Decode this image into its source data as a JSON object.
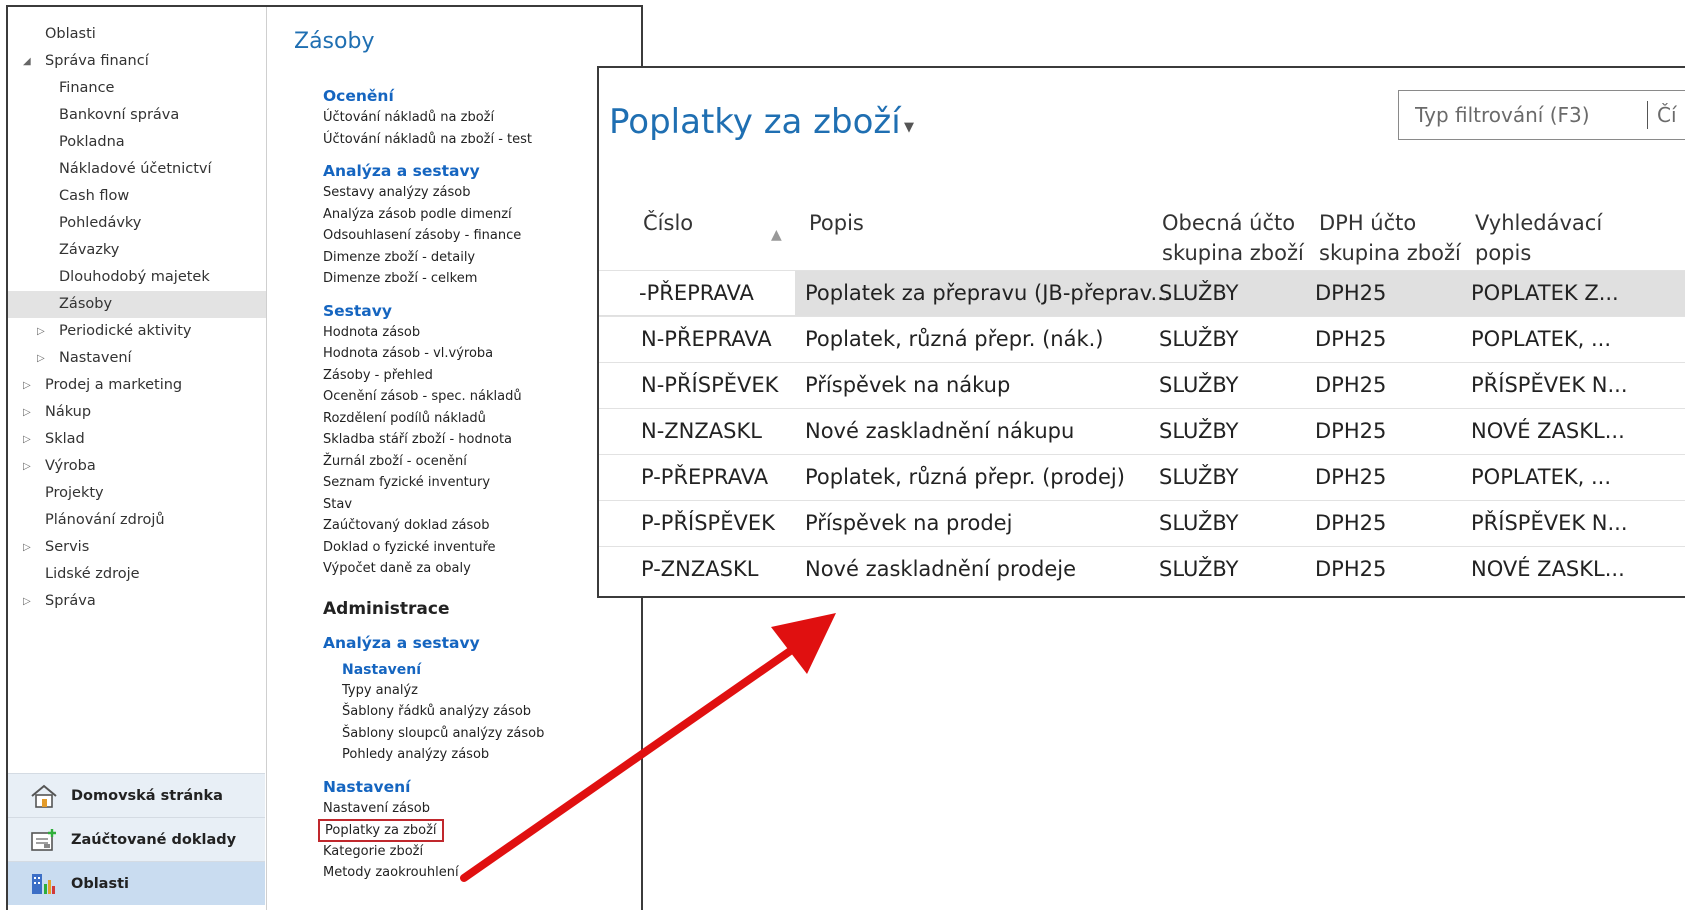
{
  "nav_tree": [
    {
      "label": "Oblasti",
      "level": 0,
      "arrow": ""
    },
    {
      "label": "Správa financí",
      "level": 0,
      "arrow": "◢"
    },
    {
      "label": "Finance",
      "level": 1,
      "arrow": ""
    },
    {
      "label": "Bankovní správa",
      "level": 1,
      "arrow": ""
    },
    {
      "label": "Pokladna",
      "level": 1,
      "arrow": ""
    },
    {
      "label": "Nákladové účetnictví",
      "level": 1,
      "arrow": ""
    },
    {
      "label": "Cash flow",
      "level": 1,
      "arrow": ""
    },
    {
      "label": "Pohledávky",
      "level": 1,
      "arrow": ""
    },
    {
      "label": "Závazky",
      "level": 1,
      "arrow": ""
    },
    {
      "label": "Dlouhodobý majetek",
      "level": 1,
      "arrow": ""
    },
    {
      "label": "Zásoby",
      "level": 1,
      "arrow": "",
      "selected": true
    },
    {
      "label": "Periodické aktivity",
      "level": 1,
      "arrow": "▷"
    },
    {
      "label": "Nastavení",
      "level": 1,
      "arrow": "▷"
    },
    {
      "label": "Prodej a marketing",
      "level": 0,
      "arrow": "▷"
    },
    {
      "label": "Nákup",
      "level": 0,
      "arrow": "▷"
    },
    {
      "label": "Sklad",
      "level": 0,
      "arrow": "▷"
    },
    {
      "label": "Výroba",
      "level": 0,
      "arrow": "▷"
    },
    {
      "label": "Projekty",
      "level": 0,
      "arrow": ""
    },
    {
      "label": "Plánování zdrojů",
      "level": 0,
      "arrow": ""
    },
    {
      "label": "Servis",
      "level": 0,
      "arrow": "▷"
    },
    {
      "label": "Lidské zdroje",
      "level": 0,
      "arrow": ""
    },
    {
      "label": "Správa",
      "level": 0,
      "arrow": "▷"
    }
  ],
  "nav_buttons": [
    {
      "label": "Domovská stránka",
      "icon": "home-icon",
      "active": false
    },
    {
      "label": "Zaúčtované doklady",
      "icon": "posted-documents-icon",
      "active": false
    },
    {
      "label": "Oblasti",
      "icon": "departments-icon",
      "active": true
    }
  ],
  "department": {
    "title": "Zásoby",
    "blocks": [
      {
        "type": "group",
        "label": "Ocenění",
        "first": true
      },
      {
        "type": "link",
        "label": "Účtování nákladů na zboží"
      },
      {
        "type": "link",
        "label": "Účtování nákladů na zboží - test"
      },
      {
        "type": "group",
        "label": "Analýza a sestavy"
      },
      {
        "type": "link",
        "label": "Sestavy analýzy zásob"
      },
      {
        "type": "link",
        "label": "Analýza zásob podle dimenzí"
      },
      {
        "type": "link",
        "label": "Odsouhlasení zásoby - finance"
      },
      {
        "type": "link",
        "label": "Dimenze zboží - detaily"
      },
      {
        "type": "link",
        "label": "Dimenze zboží - celkem"
      },
      {
        "type": "group",
        "label": "Sestavy"
      },
      {
        "type": "link",
        "label": "Hodnota zásob"
      },
      {
        "type": "link",
        "label": "Hodnota zásob - vl.výroba"
      },
      {
        "type": "link",
        "label": "Zásoby - přehled"
      },
      {
        "type": "link",
        "label": "Ocenění zásob - spec. nákladů"
      },
      {
        "type": "link",
        "label": "Rozdělení podílů nákladů"
      },
      {
        "type": "link",
        "label": "Skladba stáří zboží - hodnota"
      },
      {
        "type": "link",
        "label": "Žurnál zboží - ocenění"
      },
      {
        "type": "link",
        "label": "Seznam fyzické inventury"
      },
      {
        "type": "link",
        "label": "Stav"
      },
      {
        "type": "link",
        "label": "Zaúčtovaný doklad zásob"
      },
      {
        "type": "link",
        "label": "Doklad o fyzické inventuře"
      },
      {
        "type": "link",
        "label": "Výpočet daně za obaly"
      },
      {
        "type": "section",
        "label": "Administrace"
      },
      {
        "type": "group",
        "label": "Analýza a sestavy"
      },
      {
        "type": "subgroup",
        "label": "Nastavení"
      },
      {
        "type": "link",
        "label": "Typy analýz",
        "indent": true
      },
      {
        "type": "link",
        "label": "Šablony řádků analýzy zásob",
        "indent": true
      },
      {
        "type": "link",
        "label": "Šablony sloupců analýzy zásob",
        "indent": true
      },
      {
        "type": "link",
        "label": "Pohledy analýzy zásob",
        "indent": true
      },
      {
        "type": "group",
        "label": "Nastavení"
      },
      {
        "type": "link",
        "label": "Nastavení zásob"
      },
      {
        "type": "link",
        "label": "Poplatky za zboží",
        "highlight": true
      },
      {
        "type": "link",
        "label": "Kategorie zboží"
      },
      {
        "type": "link",
        "label": "Metody zaokrouhlení"
      }
    ]
  },
  "list": {
    "title": "Poplatky za zboží",
    "filter_placeholder": "Typ filtrování (F3)",
    "filter_field": "Čí",
    "columns": {
      "no": "Číslo",
      "desc": "Popis",
      "gen": "Obecná účto\nskupina zboží",
      "vat": "DPH účto\nskupina zboží",
      "search": "Vyhledávací\npopis"
    },
    "rows": [
      {
        "no": "-PŘEPRAVA",
        "desc": "Poplatek za přepravu (JB-přeprav...",
        "gen": "SLUŽBY",
        "vat": "DPH25",
        "search": "POPLATEK Z...",
        "selected": true
      },
      {
        "no": "N-PŘEPRAVA",
        "desc": "Poplatek, různá přepr. (nák.)",
        "gen": "SLUŽBY",
        "vat": "DPH25",
        "search": "POPLATEK, ..."
      },
      {
        "no": "N-PŘÍSPĚVEK",
        "desc": "Příspěvek na nákup",
        "gen": "SLUŽBY",
        "vat": "DPH25",
        "search": "PŘÍSPĚVEK N..."
      },
      {
        "no": "N-ZNZASKL",
        "desc": "Nové zaskladnění nákupu",
        "gen": "SLUŽBY",
        "vat": "DPH25",
        "search": "NOVÉ ZASKL..."
      },
      {
        "no": "P-PŘEPRAVA",
        "desc": "Poplatek, různá přepr. (prodej)",
        "gen": "SLUŽBY",
        "vat": "DPH25",
        "search": "POPLATEK, ..."
      },
      {
        "no": "P-PŘÍSPĚVEK",
        "desc": "Příspěvek na prodej",
        "gen": "SLUŽBY",
        "vat": "DPH25",
        "search": "PŘÍSPĚVEK N..."
      },
      {
        "no": "P-ZNZASKL",
        "desc": "Nové zaskladnění prodeje",
        "gen": "SLUŽBY",
        "vat": "DPH25",
        "search": "NOVÉ ZASKL..."
      }
    ]
  },
  "colors": {
    "accent": "#1f6fb2",
    "link_heading": "#1565c0",
    "arrow": "#e01010",
    "highlight_box": "#c0282d"
  }
}
